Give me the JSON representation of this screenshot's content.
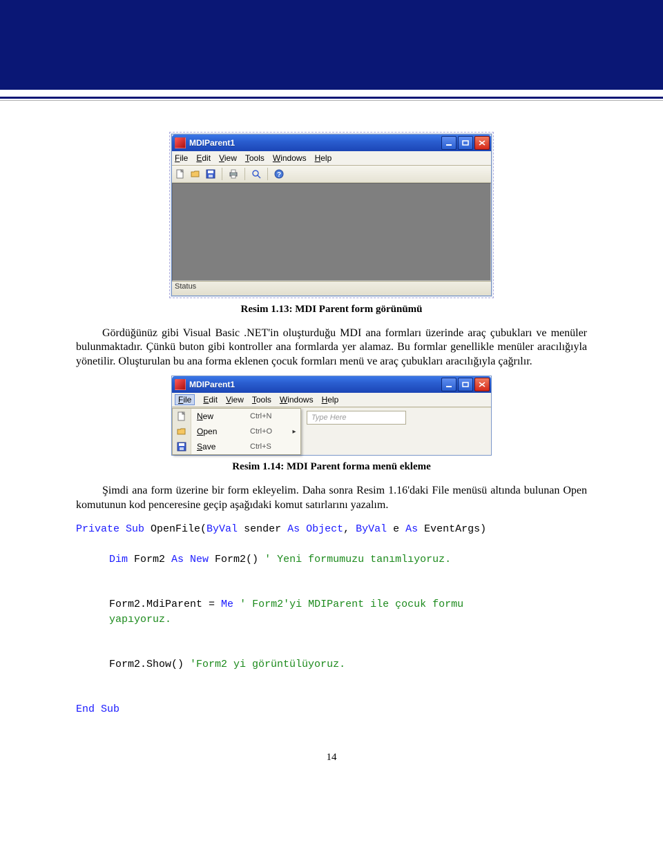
{
  "page_number": "14",
  "fig1": {
    "window_title": "MDIParent1",
    "menu": [
      "File",
      "Edit",
      "View",
      "Tools",
      "Windows",
      "Help"
    ],
    "toolbar_icons": [
      "new-file-icon",
      "open-folder-icon",
      "save-icon",
      "print-icon",
      "search-icon",
      "help-icon"
    ],
    "status": "Status",
    "caption": "Resim 1.13: MDI Parent form görünümü"
  },
  "para1": "Gördüğünüz gibi Visual Basic .NET'in oluşturduğu MDI ana formları üzerinde araç çubukları ve menüler bulunmaktadır. Çünkü buton gibi kontroller ana formlarda yer alamaz. Bu formlar genellikle menüler aracılığıyla yönetilir. Oluşturulan bu ana forma eklenen çocuk formları menü ve araç çubukları aracılığıyla çağrılır.",
  "fig2": {
    "window_title": "MDIParent1",
    "menu": [
      "File",
      "Edit",
      "View",
      "Tools",
      "Windows",
      "Help"
    ],
    "dropdown": [
      {
        "icon": "new-file-icon",
        "label": "New",
        "shortcut": "Ctrl+N",
        "arrow": false
      },
      {
        "icon": "open-folder-icon",
        "label": "Open",
        "shortcut": "Ctrl+O",
        "arrow": true
      },
      {
        "icon": "save-icon",
        "label": "Save",
        "shortcut": "Ctrl+S",
        "arrow": false
      }
    ],
    "type_here": "Type Here",
    "caption": "Resim 1.14: MDI Parent forma menü ekleme"
  },
  "para2": "Şimdi ana form üzerine bir form ekleyelim. Daha sonra Resim 1.16'daki File menüsü altında bulunan Open komutunun kod penceresine geçip aşağıdaki komut satırlarını yazalım.",
  "code": {
    "l1_a": "Private Sub",
    "l1_b": " OpenFile(",
    "l1_c": "ByVal",
    "l1_d": " sender ",
    "l1_e": "As Object",
    "l1_f": ", ",
    "l1_g": "ByVal",
    "l1_h": " e ",
    "l1_i": "As",
    "l1_j": " EventArgs)",
    "l2_a": "Dim",
    "l2_b": " Form2 ",
    "l2_c": "As New",
    "l2_d": " Form2() ",
    "l2_e": "' Yeni formumuzu tanımlıyoruz.",
    "l3_a": "Form2.MdiParent = ",
    "l3_b": "Me",
    "l3_c": " ",
    "l3_d": "' Form2'yi MDIParent ile çocuk formu",
    "l3_e": "yapıyoruz.",
    "l4_a": "Form2.Show() ",
    "l4_b": "'Form2 yi görüntülüyoruz.",
    "l5": "End Sub"
  }
}
